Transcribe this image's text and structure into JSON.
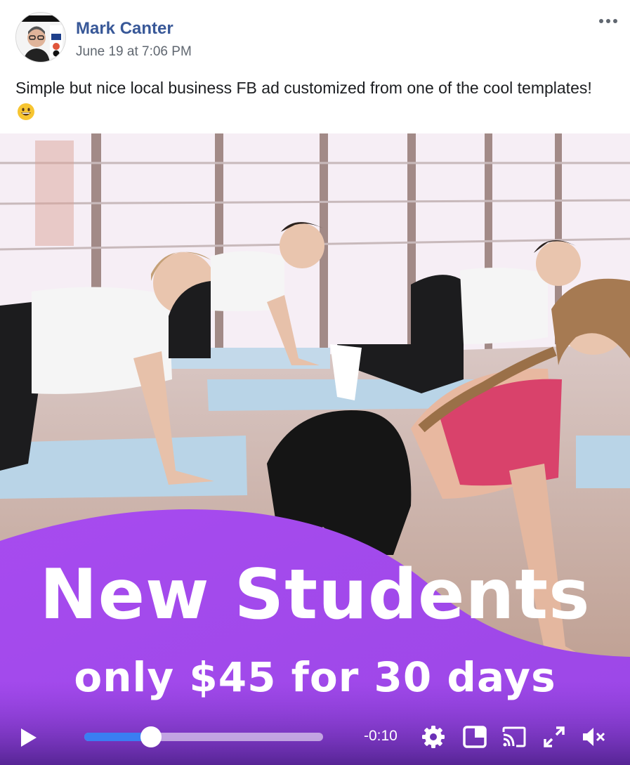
{
  "post": {
    "author": "Mark Canter",
    "timestamp": "June 19 at 7:06 PM",
    "caption": "Simple but nice local business FB ad customized from one of the cool templates!",
    "avatar_badge_text": "AS SEEN ON",
    "avatar_logos": [
      "FOX",
      "NBC",
      "abc"
    ]
  },
  "ad": {
    "headline": "New Students",
    "subline": "only $45 for 30 days",
    "accent_color": "#a44ff2"
  },
  "player": {
    "time_remaining": "-0:10",
    "progress_fraction": 0.28,
    "progress_color": "#3a7ef2"
  },
  "icons": [
    "more-icon",
    "grinning-emoji-icon",
    "play-icon",
    "settings-gear-icon",
    "picture-in-picture-icon",
    "cast-icon",
    "fullscreen-icon",
    "muted-speaker-icon"
  ]
}
